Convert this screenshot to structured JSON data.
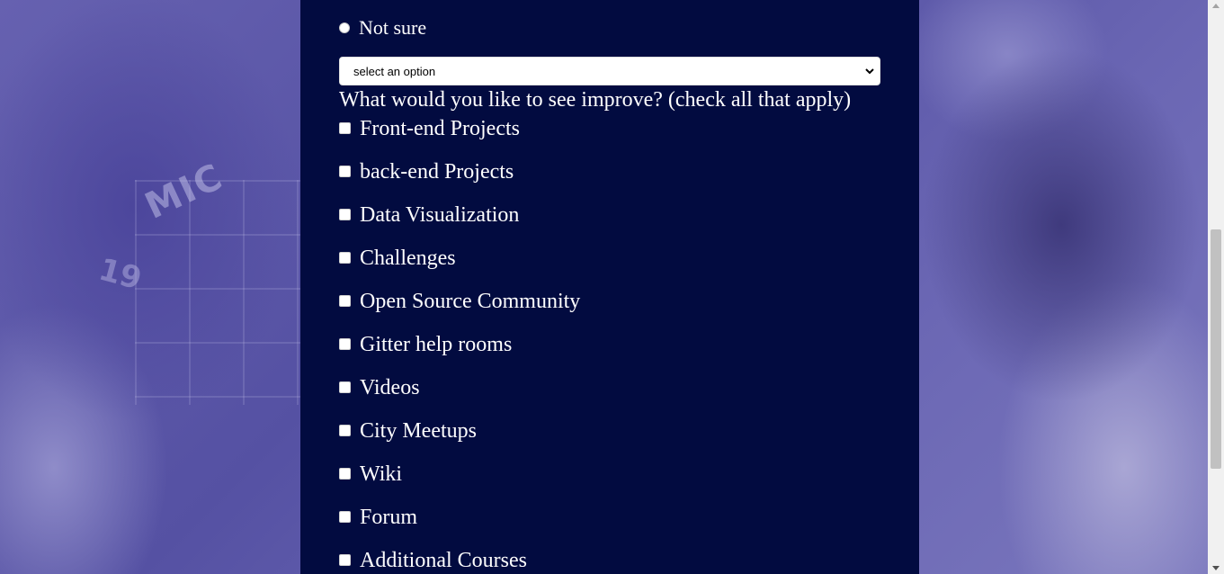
{
  "colors": {
    "panel_background": "#020b40",
    "page_background": "#5e5ba8",
    "text": "#ffffff"
  },
  "background_photo": {
    "jersey_text": "MIC",
    "jersey_number": "19"
  },
  "radio_option": {
    "label": "Not sure",
    "checked": false
  },
  "dropdown": {
    "selected": "select an option",
    "icon": "chevron-down-icon"
  },
  "improve_question": {
    "label": "What would you like to see improve? (check all that apply)"
  },
  "checkboxes": [
    {
      "label": "Front-end Projects",
      "checked": false
    },
    {
      "label": "back-end Projects",
      "checked": false
    },
    {
      "label": "Data Visualization",
      "checked": false
    },
    {
      "label": "Challenges",
      "checked": false
    },
    {
      "label": "Open Source Community",
      "checked": false
    },
    {
      "label": "Gitter help rooms",
      "checked": false
    },
    {
      "label": "Videos",
      "checked": false
    },
    {
      "label": "City Meetups",
      "checked": false
    },
    {
      "label": "Wiki",
      "checked": false
    },
    {
      "label": "Forum",
      "checked": false
    },
    {
      "label": "Additional Courses",
      "checked": false
    }
  ],
  "scrollbar": {
    "position_fraction": 0.6
  }
}
